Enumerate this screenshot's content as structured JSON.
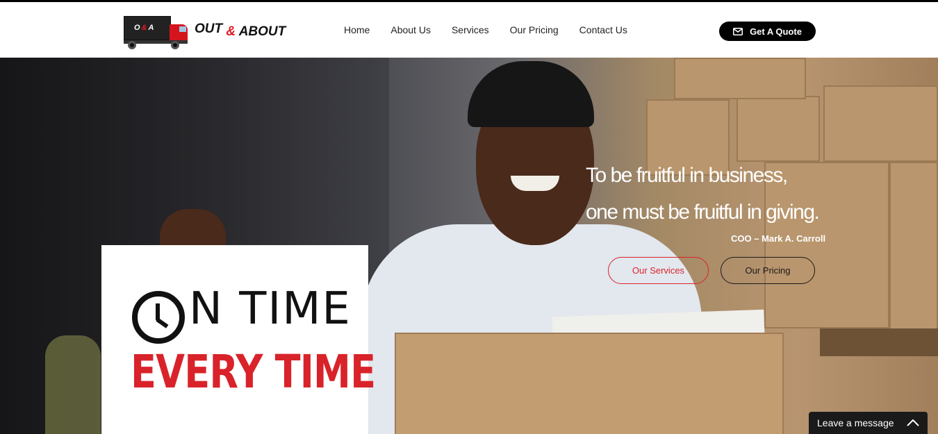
{
  "header": {
    "logo": {
      "box_text": "O&A",
      "text_out": "OUT",
      "text_amp": "&",
      "text_about": "ABOUT"
    },
    "nav": {
      "items": [
        {
          "label": "Home"
        },
        {
          "label": "About Us"
        },
        {
          "label": "Services"
        },
        {
          "label": "Our Pricing"
        },
        {
          "label": "Contact Us"
        }
      ]
    },
    "quote_button": {
      "label": "Get A Quote",
      "icon": "envelope-icon"
    }
  },
  "hero": {
    "sign": {
      "line1": "N TIME",
      "line2": "EVERY TIME"
    },
    "quote": {
      "line1": "To be fruitful in business,",
      "line2": "one must be fruitful in giving.",
      "author": "COO – Mark A. Carroll"
    },
    "buttons": {
      "services": "Our Services",
      "pricing": "Our Pricing"
    }
  },
  "chat": {
    "label": "Leave a message",
    "icon": "chevron-up-icon"
  },
  "colors": {
    "accent": "#d9232a",
    "dark": "#000000"
  }
}
